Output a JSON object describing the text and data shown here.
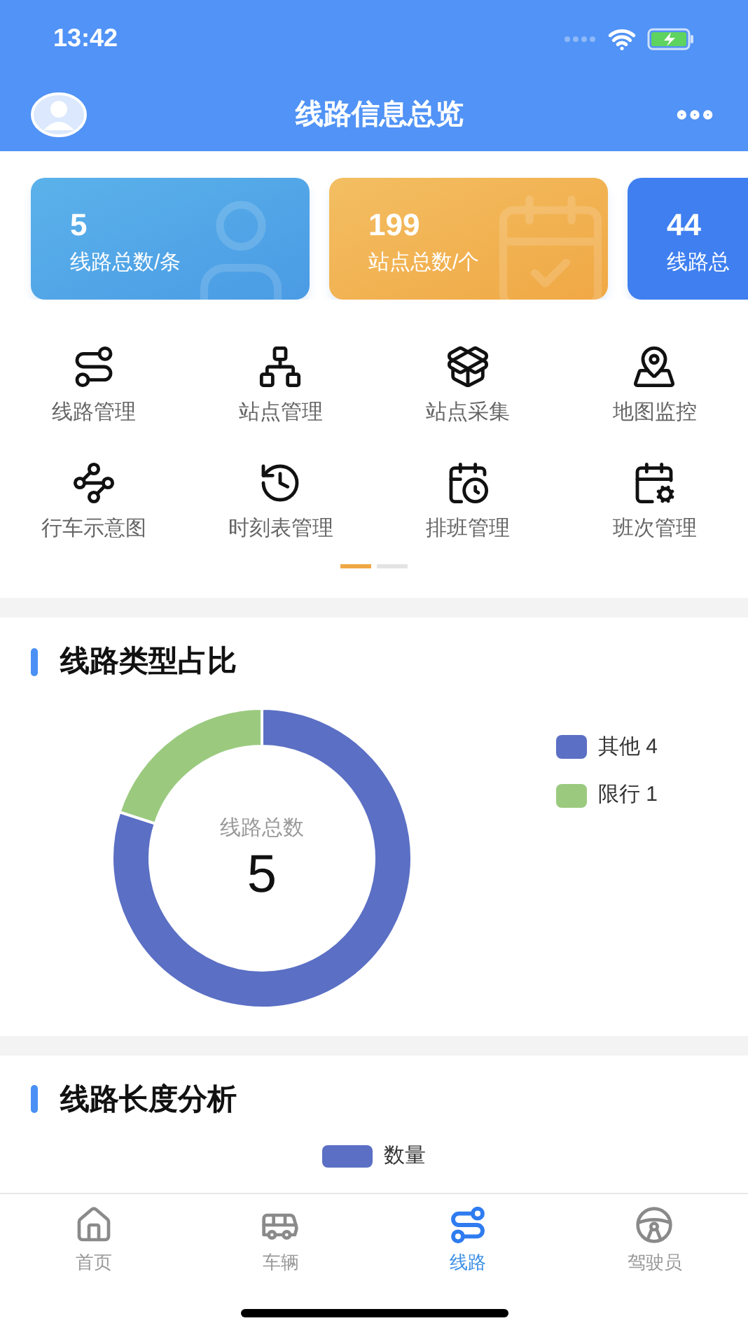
{
  "status_bar": {
    "time": "13:42"
  },
  "header": {
    "title": "线路信息总览"
  },
  "stat_cards": [
    {
      "kind": "lines",
      "value": "5",
      "label": "线路总数/条"
    },
    {
      "kind": "stations",
      "value": "199",
      "label": "站点总数/个"
    },
    {
      "kind": "length",
      "value": "44",
      "label": "线路总"
    }
  ],
  "menu": [
    {
      "kind": "route",
      "label": "线路管理"
    },
    {
      "kind": "network",
      "label": "站点管理"
    },
    {
      "kind": "box",
      "label": "站点采集"
    },
    {
      "kind": "map",
      "label": "地图监控"
    },
    {
      "kind": "path",
      "label": "行车示意图"
    },
    {
      "kind": "clock",
      "label": "时刻表管理"
    },
    {
      "kind": "calendar-clock",
      "label": "排班管理"
    },
    {
      "kind": "calendar-gear",
      "label": "班次管理"
    }
  ],
  "pager": [
    {
      "selected": true
    },
    {
      "selected": false
    }
  ],
  "type_section": {
    "title": "线路类型占比",
    "center_label": "线路总数",
    "center_value": "5",
    "chart_data": {
      "type": "donut",
      "categories": [
        "其他 4",
        "限行 1"
      ],
      "values": [
        80,
        20
      ],
      "colors": [
        "#5b6fc4",
        "#9bca7f"
      ]
    }
  },
  "length_section": {
    "title": "线路长度分析",
    "legend": [
      {
        "label": "数量",
        "color": "#5b6fc4"
      }
    ]
  },
  "tabs": [
    {
      "kind": "home",
      "label": "首页",
      "selected": false
    },
    {
      "kind": "bus",
      "label": "车辆",
      "selected": false
    },
    {
      "kind": "route",
      "label": "线路",
      "selected": true
    },
    {
      "kind": "driver",
      "label": "驾驶员",
      "selected": false
    }
  ]
}
